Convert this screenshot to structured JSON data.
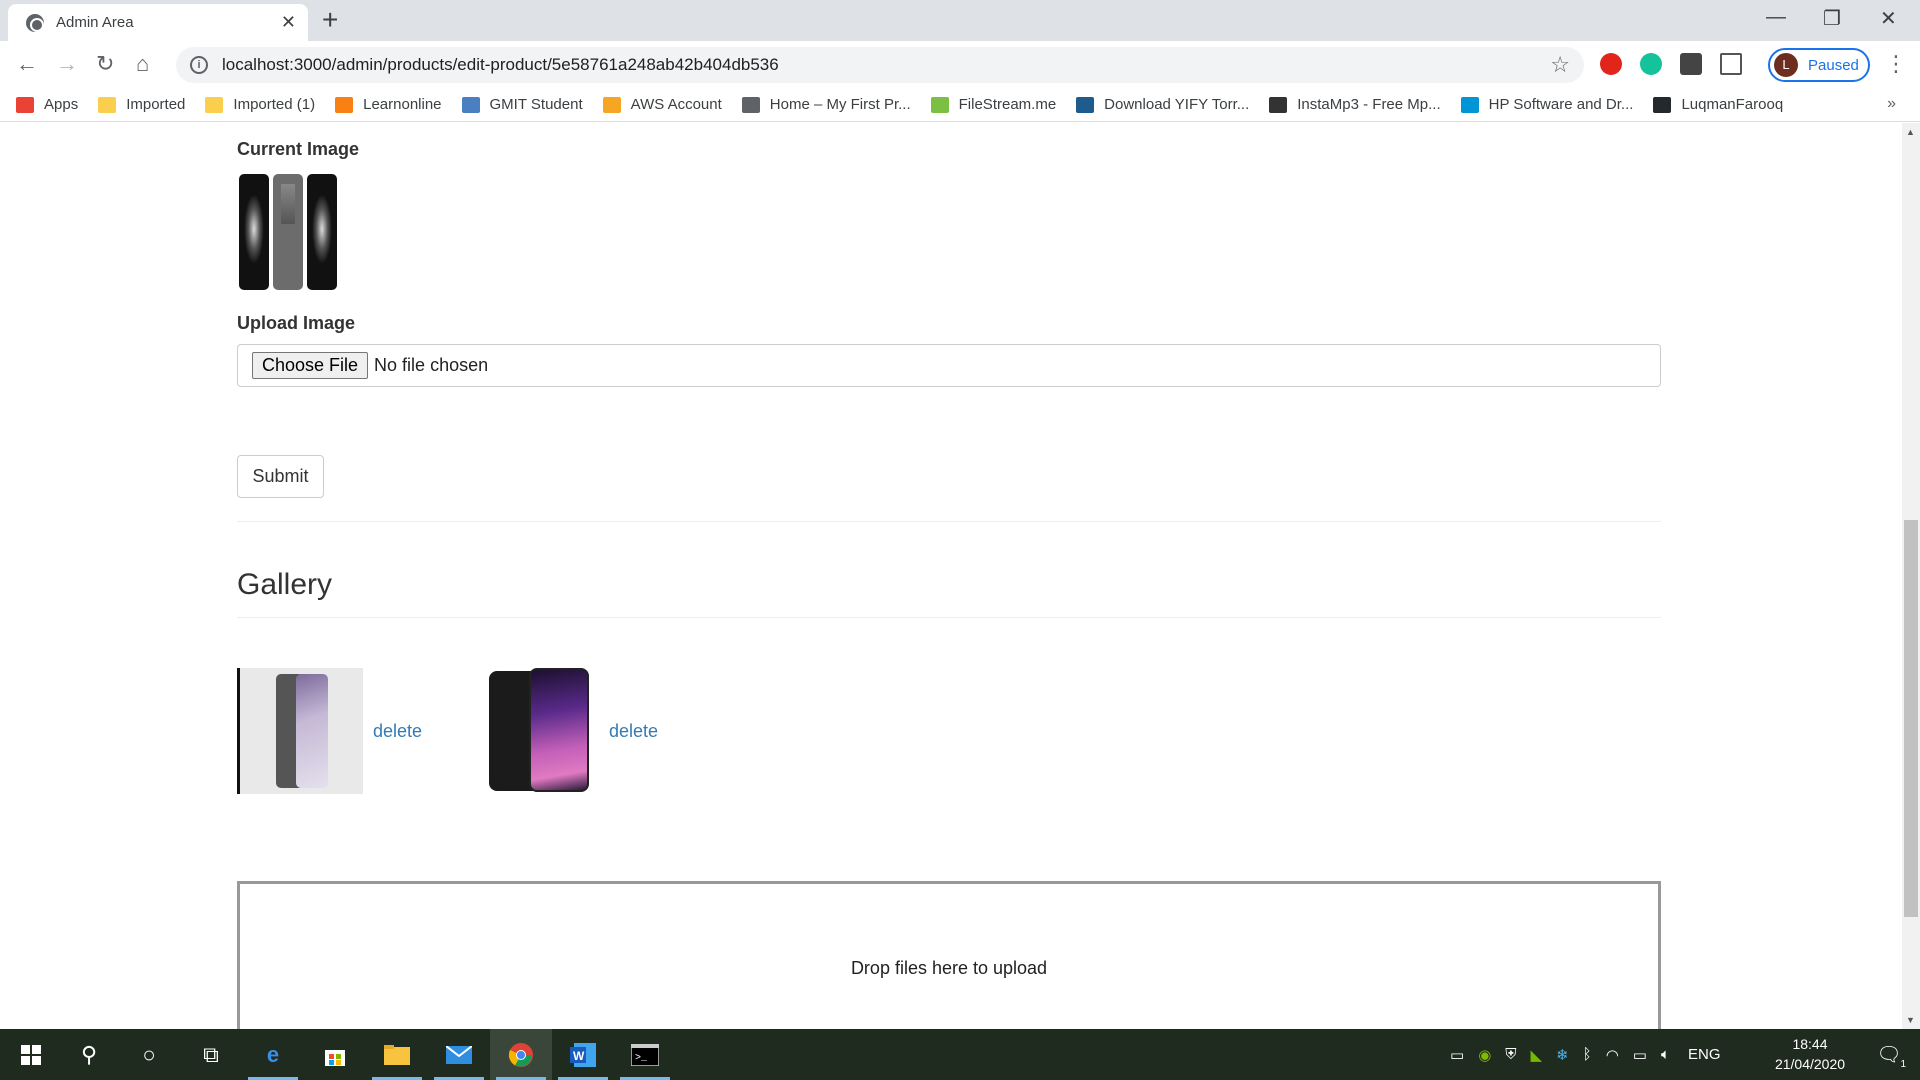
{
  "browser": {
    "tab_title": "Admin Area",
    "tab_close": "✕",
    "new_tab": "+",
    "url": "localhost:3000/admin/products/edit-product/5e58761a248ab42b404db536",
    "profile_initial": "L",
    "profile_status": "Paused",
    "window_controls": {
      "minimize": "—",
      "restore": "❐",
      "close": "✕"
    }
  },
  "bookmarks": [
    {
      "label": "Apps",
      "icon": "apps-grid-icon",
      "color": "#ea4335"
    },
    {
      "label": "Imported",
      "icon": "folder-icon",
      "color": "#f9cf4d"
    },
    {
      "label": "Imported (1)",
      "icon": "folder-icon",
      "color": "#f9cf4d"
    },
    {
      "label": "Learnonline",
      "icon": "moodle-icon",
      "color": "#f98012"
    },
    {
      "label": "GMIT Student",
      "icon": "gmit-icon",
      "color": "#4a7fc1"
    },
    {
      "label": "AWS Account",
      "icon": "aws-box-icon",
      "color": "#f5a623"
    },
    {
      "label": "Home – My First Pr...",
      "icon": "wordpress-icon",
      "color": "#5f6368"
    },
    {
      "label": "FileStream.me",
      "icon": "filestream-icon",
      "color": "#7bc043"
    },
    {
      "label": "Download YIFY Torr...",
      "icon": "film-icon",
      "color": "#1e5c8e"
    },
    {
      "label": "InstaMp3 - Free Mp...",
      "icon": "instamp3-icon",
      "color": "#333333"
    },
    {
      "label": "HP Software and Dr...",
      "icon": "hp-icon",
      "color": "#0096d6"
    },
    {
      "label": "LuqmanFarooq",
      "icon": "github-icon",
      "color": "#24292e"
    }
  ],
  "form": {
    "current_image_label": "Current Image",
    "upload_image_label": "Upload Image",
    "choose_file_label": "Choose File",
    "no_file_text": "No file chosen",
    "submit_label": "Submit"
  },
  "gallery": {
    "title": "Gallery",
    "items": [
      {
        "delete_label": "delete"
      },
      {
        "delete_label": "delete"
      }
    ]
  },
  "dropzone": {
    "text": "Drop files here to upload"
  },
  "taskbar": {
    "language": "ENG",
    "time": "18:44",
    "date": "21/04/2020",
    "notification_count": "1"
  },
  "colors": {
    "link": "#337ab7",
    "profile_accent": "#1a73e8",
    "taskbar_bg": "#1f2b1f"
  }
}
